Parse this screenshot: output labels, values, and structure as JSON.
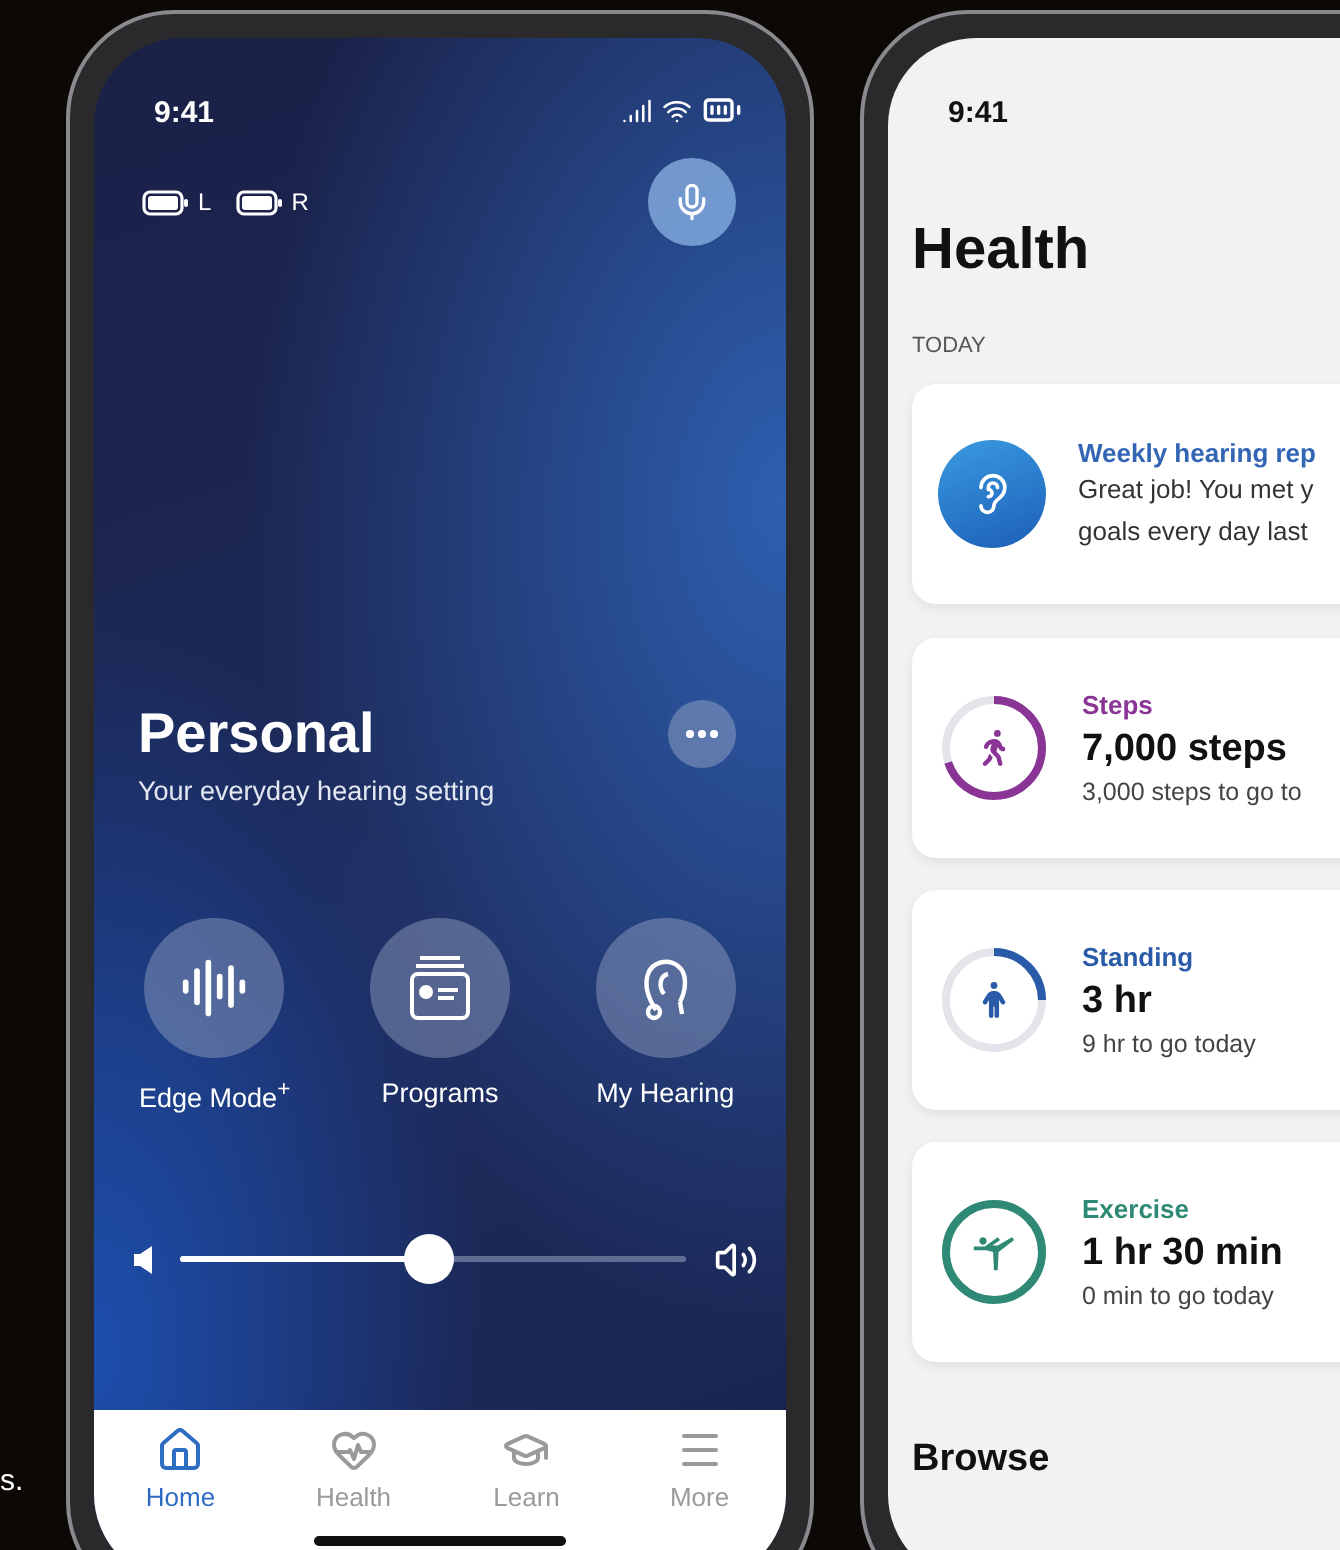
{
  "caption": "s.",
  "home_screen": {
    "status_bar": {
      "time": "9:41"
    },
    "hearing_aids": [
      {
        "side": "L"
      },
      {
        "side": "R"
      }
    ],
    "program": {
      "title": "Personal",
      "subtitle": "Your everyday hearing setting"
    },
    "actions": [
      {
        "kind": "waveform",
        "label": "Edge Mode$^{+}$"
      },
      {
        "kind": "programs",
        "label": "Programs"
      },
      {
        "kind": "hearing",
        "label": "My Hearing"
      }
    ],
    "volume": {
      "level": 0.49
    },
    "tabs": [
      {
        "kind": "home",
        "label": "Home",
        "selected": true
      },
      {
        "kind": "health",
        "label": "Health",
        "selected": false
      },
      {
        "kind": "learn",
        "label": "Learn",
        "selected": false
      },
      {
        "kind": "more",
        "label": "More",
        "selected": false
      }
    ]
  },
  "health_screen": {
    "status_bar": {
      "time": "9:41"
    },
    "title": "Health",
    "section": "TODAY",
    "report": {
      "title": "Weekly hearing rep",
      "lines": [
        "Great job! You met y",
        "goals every day last"
      ]
    },
    "activities": [
      {
        "kind": "steps",
        "label": "Steps",
        "value": "7,000 steps",
        "note": "3,000 steps to go to",
        "level": 0.7,
        "color": "#8a3596"
      },
      {
        "kind": "standing",
        "label": "Standing",
        "value": "3 hr",
        "note": "9 hr to go today",
        "level": 0.25,
        "color": "#2a5ba8"
      },
      {
        "kind": "exercise",
        "label": "Exercise",
        "value": "1 hr 30 min",
        "note": "0 min to go today",
        "level": 1,
        "color": "#2e8a74"
      }
    ],
    "browse": "Browse"
  }
}
